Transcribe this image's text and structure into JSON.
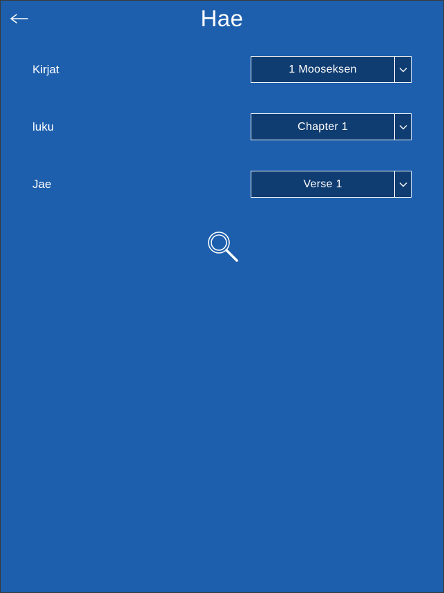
{
  "header": {
    "title": "Hae"
  },
  "form": {
    "rows": [
      {
        "label": "Kirjat",
        "selected": "1 Mooseksen"
      },
      {
        "label": "luku",
        "selected": "Chapter 1"
      },
      {
        "label": "Jae",
        "selected": "Verse 1"
      }
    ]
  },
  "colors": {
    "background": "#1d5fad",
    "selectBackground": "#103d71",
    "border": "#ffffff"
  }
}
